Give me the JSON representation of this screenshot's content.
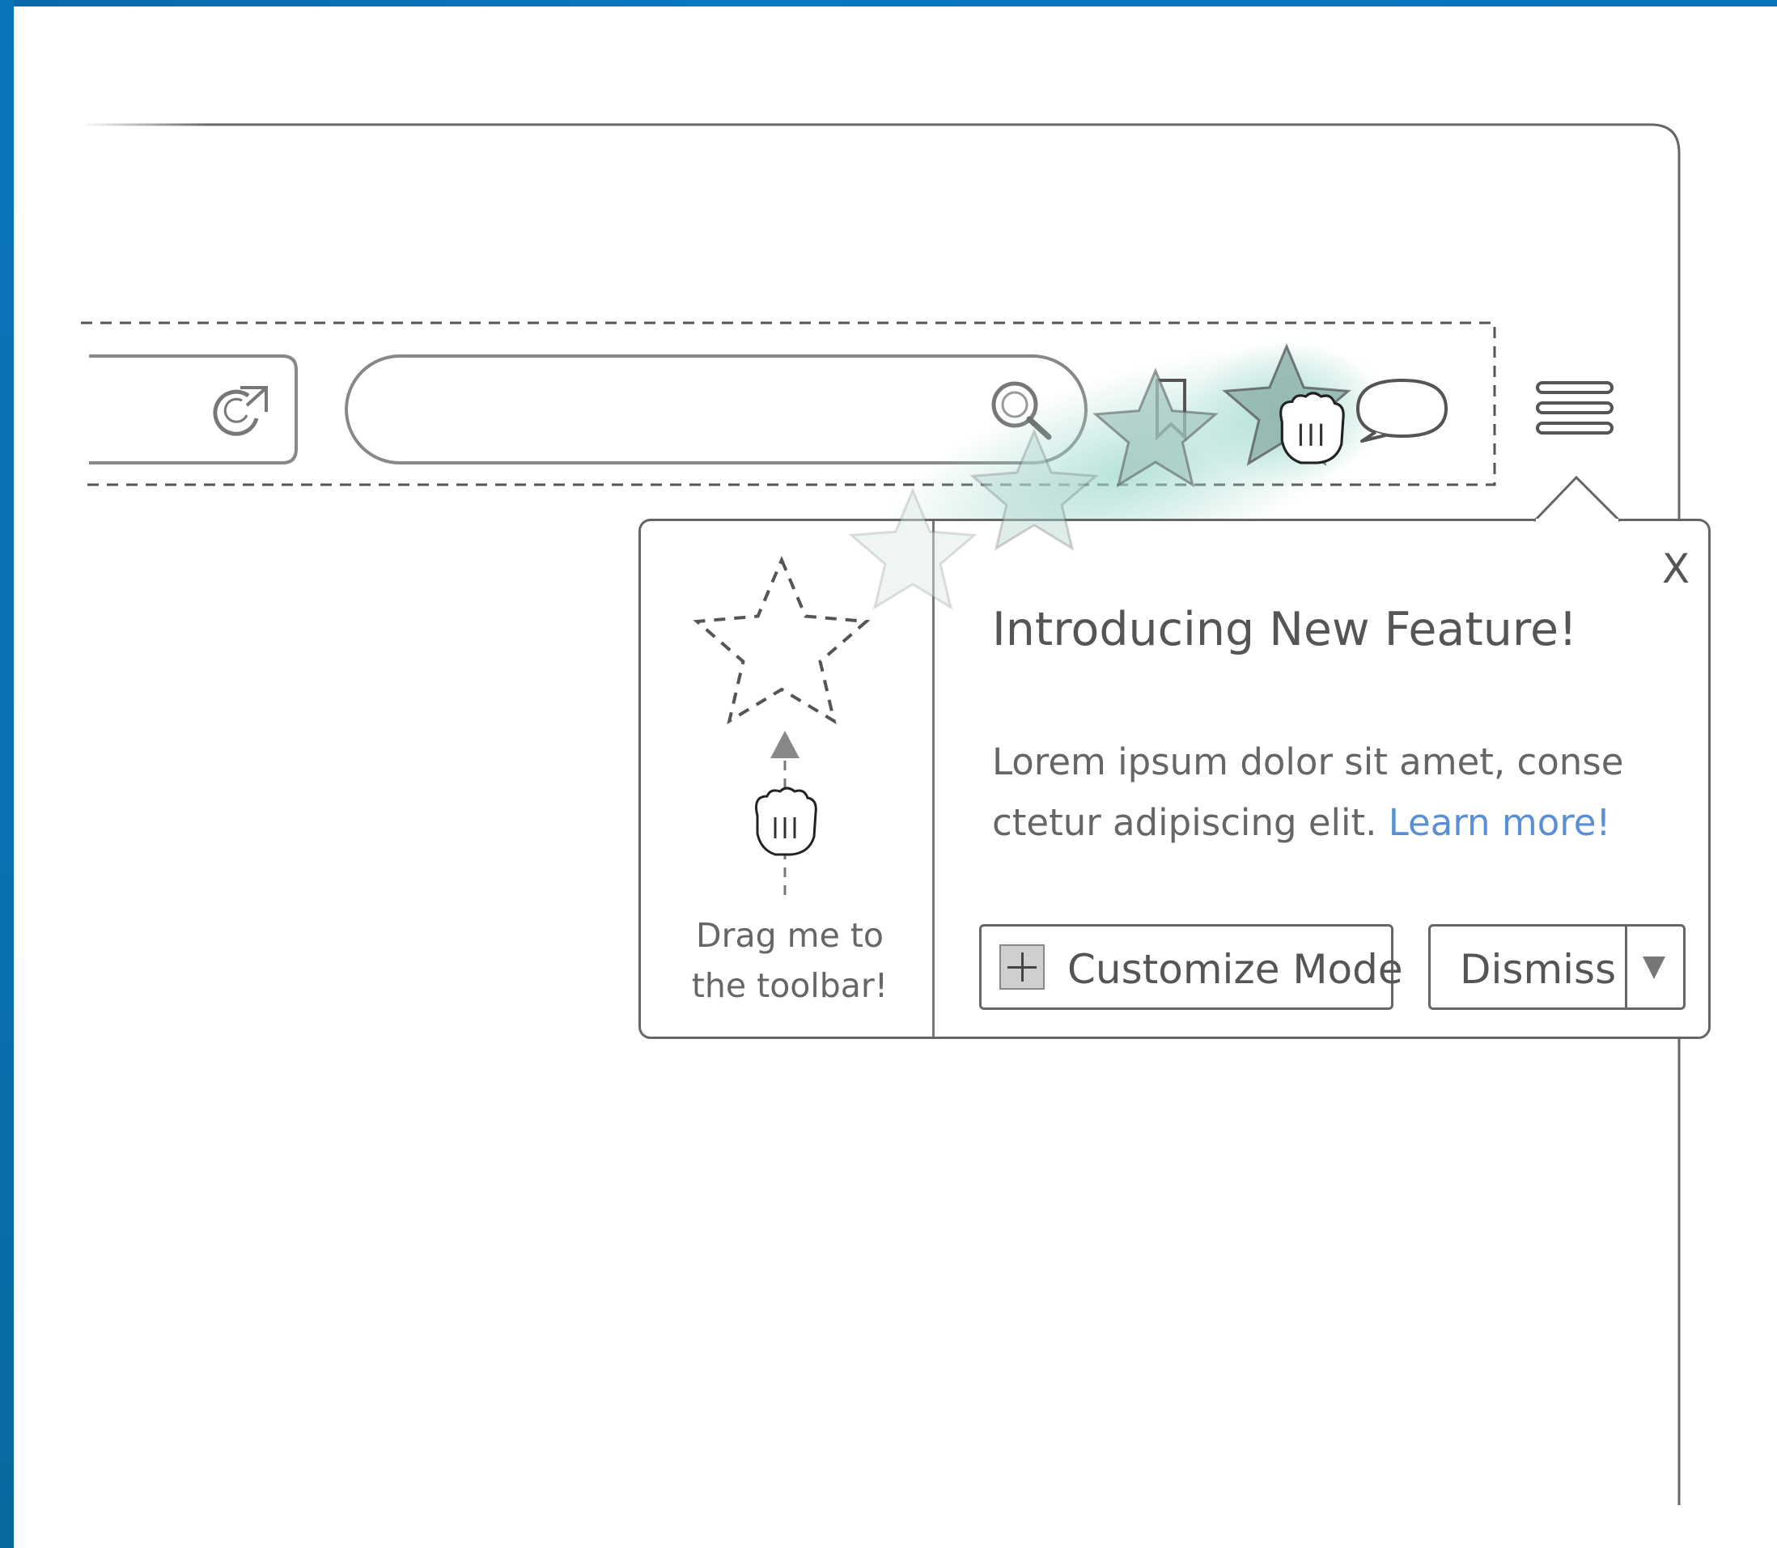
{
  "popup": {
    "close_label": "X",
    "title": "Introducing New Feature!",
    "body_text": "Lorem ipsum dolor sit amet, conse ctetur adipiscing elit.",
    "link_text": "Learn more!",
    "drag_hint_line1": "Drag me to",
    "drag_hint_line2": "the toolbar!"
  },
  "buttons": {
    "customize_label": "Customize Mode",
    "dismiss_label": "Dismiss"
  },
  "icons": {
    "reload": "reload-icon",
    "search": "search-icon",
    "star": "star-icon",
    "chat": "chat-bubble-icon",
    "menu": "hamburger-menu-icon",
    "hand": "grab-hand-icon",
    "plus": "plus-icon",
    "dropdown": "dropdown-arrow-icon"
  },
  "colors": {
    "frame_blue": "#0a74bc",
    "link_blue": "#5a8fd6",
    "stroke_gray": "#666666",
    "star_teal": "#a7c8c3"
  }
}
